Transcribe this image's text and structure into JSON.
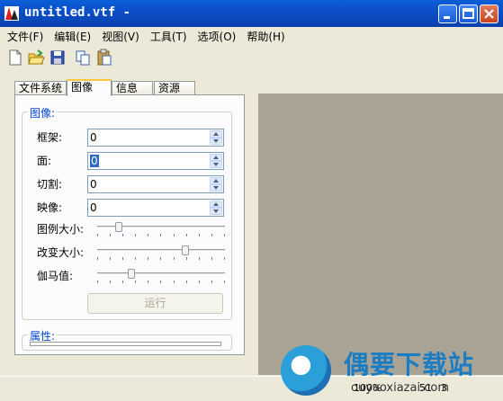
{
  "window": {
    "title": "untitled.vtf -"
  },
  "menu": [
    "文件(F)",
    "编辑(E)",
    "视图(V)",
    "工具(T)",
    "选项(O)",
    "帮助(H)"
  ],
  "toolbar": {
    "icons": [
      "new-file-icon",
      "open-folder-icon",
      "save-icon",
      "copy-icon",
      "paste-icon"
    ]
  },
  "tabs": [
    "文件系统",
    "图像",
    "信息",
    "资源"
  ],
  "image_group": {
    "title": "图像:",
    "frame_label": "框架:",
    "frame_value": "0",
    "face_label": "面:",
    "face_value": "0",
    "slice_label": "切割:",
    "slice_value": "0",
    "mipmap_label": "映像:",
    "mipmap_value": "0",
    "legend_size_label": "图例大小:",
    "legend_size_level": 0.15,
    "resize_label": "改变大小:",
    "resize_level": 0.7,
    "gamma_label": "伽马值:",
    "gamma_level": 0.25,
    "run_label": "运行"
  },
  "properties_group": {
    "title": "属性:"
  },
  "status": {
    "zoom": "100%",
    "x": "51",
    "y": "3"
  },
  "watermark": {
    "brand": "偶要下载站",
    "site": "ouyaoxiazai.com"
  },
  "colors": {
    "accent": "#0046d5",
    "view_bg": "#a9a396",
    "titlebar": "#0b4fc8"
  }
}
